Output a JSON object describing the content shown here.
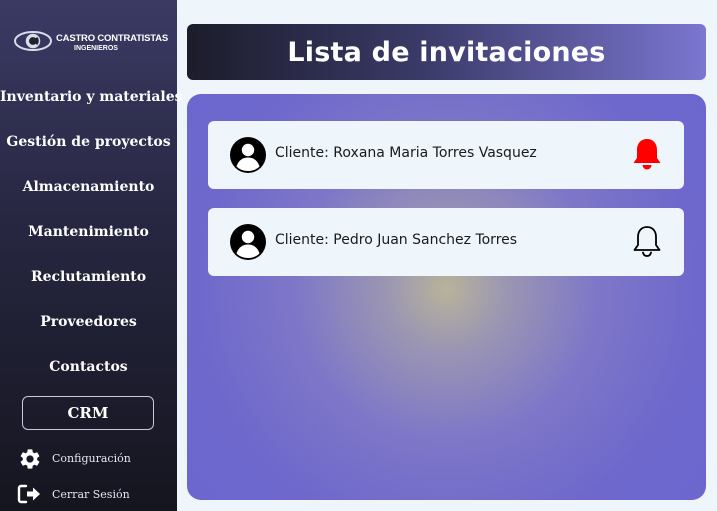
{
  "brand": {
    "name": "CASTRO CONTRATISTAS",
    "subtitle": "INGENIEROS"
  },
  "sidebar": {
    "items": [
      {
        "label": "Inventario y materiales"
      },
      {
        "label": "Gestión de proyectos"
      },
      {
        "label": "Almacenamiento"
      },
      {
        "label": "Mantenimiento"
      },
      {
        "label": "Reclutamiento"
      },
      {
        "label": "Proveedores"
      },
      {
        "label": "Contactos"
      },
      {
        "label": "CRM"
      }
    ],
    "settings_label": "Configuración",
    "logout_label": "Cerrar Sesión"
  },
  "header": {
    "title": "Lista de invitaciones"
  },
  "invitations": [
    {
      "label": "Cliente: Roxana Maria Torres Vasquez",
      "bell_icon": "bell-filled-icon",
      "bell_color": "#ff0000"
    },
    {
      "label": "Cliente: Pedro Juan Sanchez Torres",
      "bell_icon": "bell-outline-icon",
      "bell_color": "#000000"
    }
  ],
  "colors": {
    "sidebar_top": "#3b3a64",
    "sidebar_bottom": "#15151f",
    "panel": "#6e68cc",
    "card_bg": "#eef5fb",
    "alert_bell": "#ff0000"
  }
}
